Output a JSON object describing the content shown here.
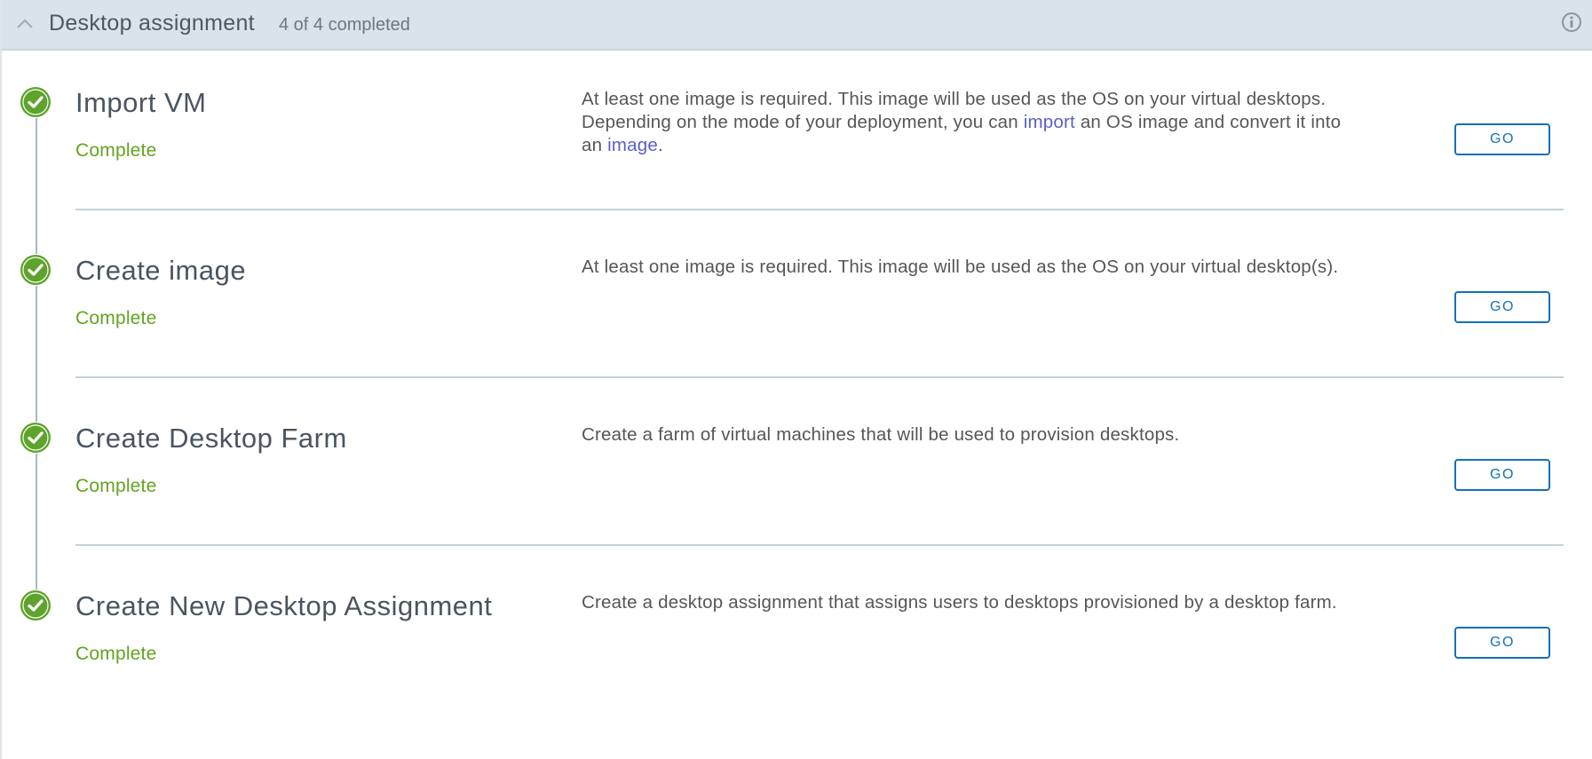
{
  "header": {
    "title": "Desktop assignment",
    "progress_text": "4 of 4 completed",
    "chevron_icon": "chevron-up-icon",
    "info_icon": "info-icon"
  },
  "colors": {
    "header_bg": "#d8e3ea",
    "complete_green": "#62a420",
    "check_green": "#5ea32b",
    "link_purple": "#5b5fc7",
    "button_blue": "#1470b6"
  },
  "steps": [
    {
      "title": "Import VM",
      "status": "Complete",
      "desc_parts": [
        {
          "text": "At least one image is required. This image will be used as the OS on your virtual desktops. Depending on the mode of your deployment, you can "
        },
        {
          "text": "import",
          "link": true
        },
        {
          "text": " an OS image and convert it into an "
        },
        {
          "text": "image",
          "link": true
        },
        {
          "text": "."
        }
      ],
      "button_label": "GO"
    },
    {
      "title": "Create image",
      "status": "Complete",
      "desc_parts": [
        {
          "text": "At least one image is required. This image will be used as the OS on your virtual desktop(s)."
        }
      ],
      "button_label": "GO"
    },
    {
      "title": "Create Desktop Farm",
      "status": "Complete",
      "desc_parts": [
        {
          "text": "Create a farm of virtual machines that will be used to provision desktops."
        }
      ],
      "button_label": "GO"
    },
    {
      "title": "Create New Desktop Assignment",
      "status": "Complete",
      "desc_parts": [
        {
          "text": "Create a desktop assignment that assigns users to desktops provisioned by a desktop farm."
        }
      ],
      "button_label": "GO"
    }
  ]
}
